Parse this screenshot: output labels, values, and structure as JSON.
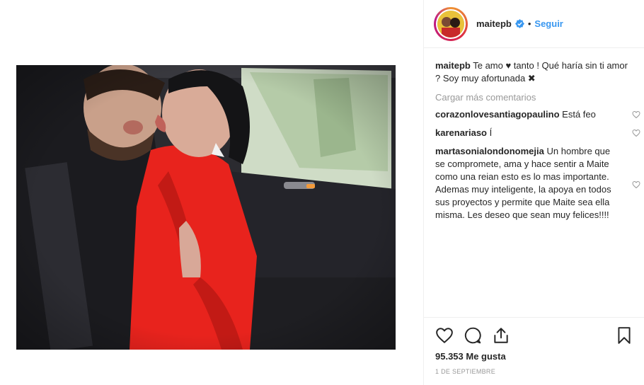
{
  "post": {
    "username": "maitepb",
    "separator": "•",
    "follow_label": "Seguir",
    "caption_user": "maitepb",
    "caption_text": "Te amo ♥ tanto ! Qué haría sin ti amor ? Soy muy afortunada ✖",
    "load_more": "Cargar más comentarios",
    "comments": [
      {
        "user": "corazonlovesantiagopaulino",
        "text": "Está feo"
      },
      {
        "user": "karenariaso",
        "text": "Í"
      },
      {
        "user": "martasonialondonomejia",
        "text": "Un hombre que se compromete, ama y hace sentir a Maite como una reian esto es lo mas importante. Ademas muy inteligente, la apoya en todos sus proyectos y permite que Maite sea ella misma. Les deseo que sean muy felices!!!!"
      }
    ],
    "likes": "95.353 Me gusta",
    "date": "1 DE SEPTIEMBRE"
  },
  "colors": {
    "accent": "#3897f0",
    "muted": "#999999",
    "text": "#262626",
    "dress": "#e8231d"
  },
  "icons": [
    "verified-icon",
    "heart-icon",
    "comment-icon",
    "share-icon",
    "bookmark-icon"
  ]
}
